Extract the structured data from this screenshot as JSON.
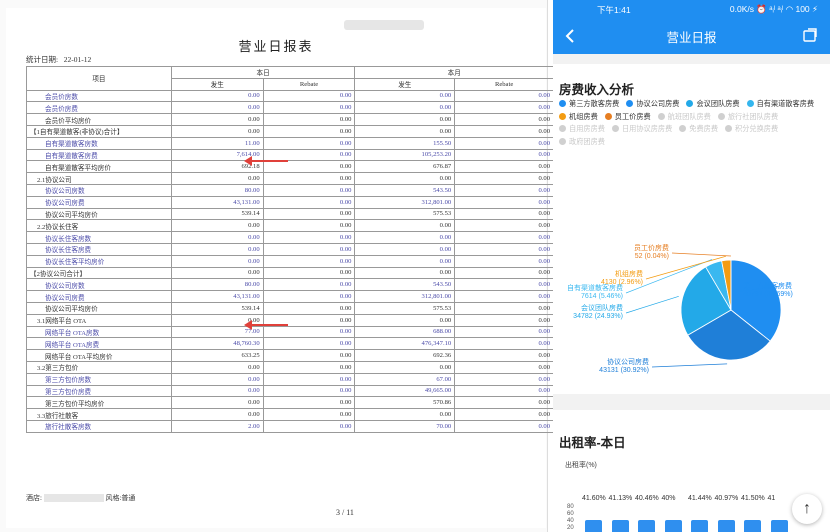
{
  "report": {
    "title": "营业日报表",
    "stat_date_label": "统计日期:",
    "stat_date": "22-01-12",
    "header": {
      "item": "项目",
      "today": "本日",
      "month": "本月",
      "occur": "发生",
      "rebate": "Rebate"
    },
    "rows": [
      {
        "label": "会员价房数",
        "style": "link",
        "d": "0.00",
        "dr": "0.00",
        "m": "0.00",
        "mr": "0.00"
      },
      {
        "label": "会员价房费",
        "style": "link",
        "d": "0.00",
        "dr": "0.00",
        "m": "0.00",
        "mr": "0.00"
      },
      {
        "label": "会员价平均房价",
        "style": "plain",
        "d": "0.00",
        "dr": "0.00",
        "m": "0.00",
        "mr": "0.00"
      },
      {
        "label": "【1自有渠道散客(非协议)合计】",
        "style": "group",
        "d": "0.00",
        "dr": "0.00",
        "m": "0.00",
        "mr": "0.00"
      },
      {
        "label": "自有渠道散客房数",
        "style": "link",
        "d": "11.00",
        "dr": "0.00",
        "m": "155.50",
        "mr": "0.00"
      },
      {
        "label": "自有渠道散客房费",
        "style": "link",
        "d": "7,614.00",
        "dr": "0.00",
        "m": "105,253.20",
        "mr": "0.00"
      },
      {
        "label": "自有渠道散客平均房价",
        "style": "plain",
        "d": "692.18",
        "dr": "0.00",
        "m": "676.87",
        "mr": "0.00"
      },
      {
        "label": "2.1协议公司",
        "style": "sub",
        "d": "0.00",
        "dr": "0.00",
        "m": "0.00",
        "mr": "0.00"
      },
      {
        "label": "协议公司房数",
        "style": "link",
        "d": "80.00",
        "dr": "0.00",
        "m": "543.50",
        "mr": "0.00"
      },
      {
        "label": "协议公司房费",
        "style": "link",
        "d": "43,131.00",
        "dr": "0.00",
        "m": "312,801.00",
        "mr": "0.00"
      },
      {
        "label": "协议公司平均房价",
        "style": "plain",
        "d": "539.14",
        "dr": "0.00",
        "m": "575.53",
        "mr": "0.00"
      },
      {
        "label": "2.2协议长住客",
        "style": "sub",
        "d": "0.00",
        "dr": "0.00",
        "m": "0.00",
        "mr": "0.00"
      },
      {
        "label": "协议长住客房数",
        "style": "link",
        "d": "0.00",
        "dr": "0.00",
        "m": "0.00",
        "mr": "0.00"
      },
      {
        "label": "协议长住客房费",
        "style": "link",
        "d": "0.00",
        "dr": "0.00",
        "m": "0.00",
        "mr": "0.00"
      },
      {
        "label": "协议长住客平均房价",
        "style": "link",
        "d": "0.00",
        "dr": "0.00",
        "m": "0.00",
        "mr": "0.00"
      },
      {
        "label": "【2协议公司合计】",
        "style": "group",
        "d": "0.00",
        "dr": "0.00",
        "m": "0.00",
        "mr": "0.00"
      },
      {
        "label": "协议公司房数",
        "style": "link",
        "d": "80.00",
        "dr": "0.00",
        "m": "543.50",
        "mr": "0.00"
      },
      {
        "label": "协议公司房费",
        "style": "link",
        "d": "43,131.00",
        "dr": "0.00",
        "m": "312,801.00",
        "mr": "0.00"
      },
      {
        "label": "协议公司平均房价",
        "style": "plain",
        "d": "539.14",
        "dr": "0.00",
        "m": "575.53",
        "mr": "0.00"
      },
      {
        "label": "3.1网络平台 OTA",
        "style": "sub",
        "d": "0.00",
        "dr": "0.00",
        "m": "0.00",
        "mr": "0.00"
      },
      {
        "label": "网络平台 OTA房数",
        "style": "link",
        "d": "77.00",
        "dr": "0.00",
        "m": "688.00",
        "mr": "0.00"
      },
      {
        "label": "网络平台 OTA房费",
        "style": "link",
        "d": "48,760.30",
        "dr": "0.00",
        "m": "476,347.10",
        "mr": "0.00"
      },
      {
        "label": "网络平台 OTA平均房价",
        "style": "plain",
        "d": "633.25",
        "dr": "0.00",
        "m": "692.36",
        "mr": "0.00"
      },
      {
        "label": "3.2第三方包价",
        "style": "sub",
        "d": "0.00",
        "dr": "0.00",
        "m": "0.00",
        "mr": "0.00"
      },
      {
        "label": "第三方包价房数",
        "style": "link",
        "d": "0.00",
        "dr": "0.00",
        "m": "67.00",
        "mr": "0.00"
      },
      {
        "label": "第三方包价房费",
        "style": "link",
        "d": "0.00",
        "dr": "0.00",
        "m": "49,665.00",
        "mr": "0.00"
      },
      {
        "label": "第三方包价平均房价",
        "style": "plain",
        "d": "0.00",
        "dr": "0.00",
        "m": "570.86",
        "mr": "0.00"
      },
      {
        "label": "3.3旅行社散客",
        "style": "sub",
        "d": "0.00",
        "dr": "0.00",
        "m": "0.00",
        "mr": "0.00"
      },
      {
        "label": "旅行社散客房数",
        "style": "link",
        "d": "2.00",
        "dr": "0.00",
        "m": "70.00",
        "mr": "0.00"
      }
    ],
    "footer_hotel": "酒店:",
    "footer_style": "风格:普通",
    "page": "3 / 11"
  },
  "app": {
    "status_time": "下午1:41",
    "status_right": "0.0K/s ⏰ ᵃᵢˡ ᵃᵢˡ ◠ 100 ⚡",
    "back_icon": "chevron-left-icon",
    "nav_title": "营业日报",
    "export_icon": "export-icon",
    "revenue_title": "房费收入分析",
    "legend": [
      {
        "label": "第三方散客房费",
        "color": "#1f8ef1",
        "on": true
      },
      {
        "label": "协议公司房费",
        "color": "#1f8ef1",
        "on": true
      },
      {
        "label": "会议团队房费",
        "color": "#23a9e8",
        "on": true
      },
      {
        "label": "自有渠道散客房费",
        "color": "#34b6ee",
        "on": true
      },
      {
        "label": "机组房费",
        "color": "#f39c12",
        "on": true
      },
      {
        "label": "员工价房费",
        "color": "#e67e22",
        "on": true
      },
      {
        "label": "航班团队房费",
        "color": "#d0d0d0",
        "on": false
      },
      {
        "label": "旅行社团队房费",
        "color": "#d0d0d0",
        "on": false
      },
      {
        "label": "自用房房费",
        "color": "#d0d0d0",
        "on": false
      },
      {
        "label": "日用协议房房费",
        "color": "#d0d0d0",
        "on": false
      },
      {
        "label": "免费房费",
        "color": "#d0d0d0",
        "on": false
      },
      {
        "label": "积分兑换房费",
        "color": "#d0d0d0",
        "on": false
      },
      {
        "label": "政府团房费",
        "color": "#d0d0d0",
        "on": false
      }
    ],
    "occupancy_title": "出租率-本日",
    "occupancy_axis": "出租率(%)",
    "occupancy_ticks": [
      "80",
      "60",
      "40",
      "20"
    ],
    "scroll_top_icon": "arrow-up-icon"
  },
  "chart_data": [
    {
      "type": "pie",
      "title": "房费收入分析",
      "slices": [
        {
          "name": "第三方散客房费",
          "value": 49791,
          "label": "49791 (35.69%)",
          "color": "#1f8ef1"
        },
        {
          "name": "协议公司房费",
          "value": 43131,
          "label": "43131 (30.92%)",
          "color": "#1f7fd8"
        },
        {
          "name": "会议团队房费",
          "value": 34782,
          "label": "34782 (24.93%)",
          "color": "#23a9e8"
        },
        {
          "name": "自有渠道散客房费",
          "value": 7614,
          "label": "7614 (5.46%)",
          "color": "#3ab8f0"
        },
        {
          "name": "机组房费",
          "value": 4130,
          "label": "4130 (2.96%)",
          "color": "#f39c12"
        },
        {
          "name": "员工价房费",
          "value": 52,
          "label": "52 (0.04%)",
          "color": "#e67e22"
        }
      ]
    },
    {
      "type": "bar",
      "title": "出租率-本日",
      "ylabel": "出租率(%)",
      "ylim": [
        0,
        80
      ],
      "labels": [
        "41.60%",
        "41.13%",
        "40.46%",
        "40%",
        "41.44%",
        "40.97%",
        "41.50%",
        "41"
      ],
      "values": [
        41.6,
        41.13,
        40.46,
        40,
        41.44,
        40.97,
        41.5,
        41
      ]
    }
  ]
}
